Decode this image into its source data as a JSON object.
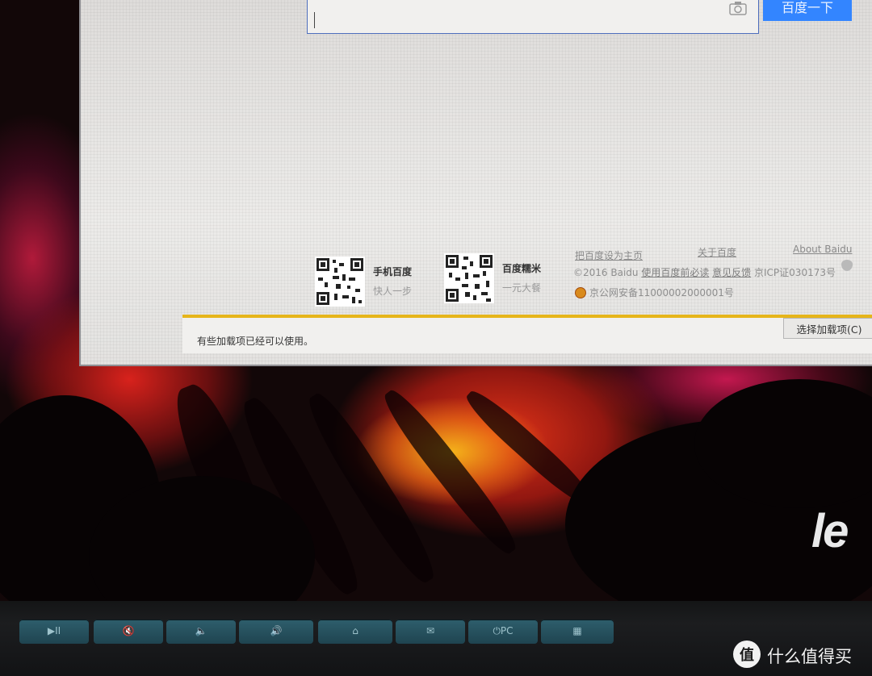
{
  "search": {
    "placeholder": "",
    "button_label": "百度一下"
  },
  "qr_codes": [
    {
      "title": "手机百度",
      "subtitle": "快人一步"
    },
    {
      "title": "百度糯米",
      "subtitle": "一元大餐"
    }
  ],
  "footer": {
    "links_row": [
      "把百度设为主页",
      "关于百度",
      "About Baidu"
    ],
    "copyright_prefix": "©2016 Baidu",
    "terms_link": "使用百度前必读",
    "feedback_link": "意见反馈",
    "icp": "京ICP证030173号",
    "police": "京公网安备11000002000001号"
  },
  "notification": {
    "message": "有些加载项已经可以使用。",
    "button_label": "选择加载项(C)"
  },
  "brand": {
    "wallpaper_logo": "le",
    "watermark": "什么值得买"
  },
  "colors": {
    "search_button": "#3385ff",
    "notify_border": "#e6b51a",
    "key_color": "#2a5a68"
  },
  "keys": [
    "▶II",
    "🔇",
    "🔈",
    "🔊",
    "⌂",
    "✉",
    "⏻PC",
    "▦"
  ]
}
